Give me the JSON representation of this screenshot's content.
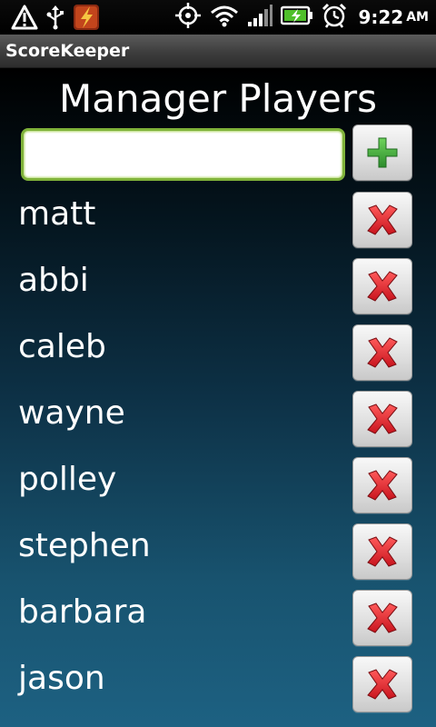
{
  "status_bar": {
    "time": "9:22",
    "ampm": "AM"
  },
  "app": {
    "title": "ScoreKeeper"
  },
  "page": {
    "title": "Manager Players"
  },
  "add_player": {
    "input_value": "",
    "add_icon": "plus-icon",
    "add_icon_color": "#3aa53a"
  },
  "players": [
    {
      "name": "matt"
    },
    {
      "name": "abbi"
    },
    {
      "name": "caleb"
    },
    {
      "name": "wayne"
    },
    {
      "name": "polley"
    },
    {
      "name": "stephen"
    },
    {
      "name": "barbara"
    },
    {
      "name": "jason"
    }
  ],
  "remove_icon": "red-x-icon",
  "remove_icon_color": "#e0202a"
}
